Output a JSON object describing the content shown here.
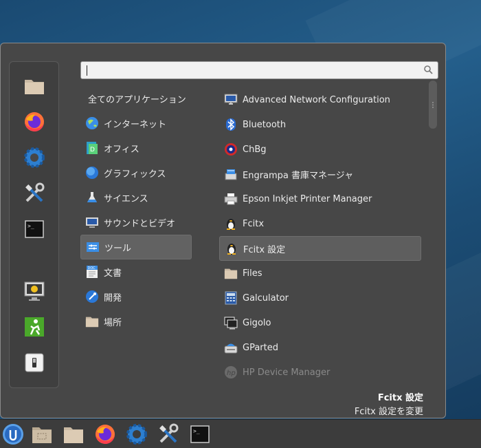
{
  "search": {
    "placeholder": ""
  },
  "categories": [
    {
      "label": "全てのアプリケーション",
      "icon": "none"
    },
    {
      "label": "インターネット",
      "icon": "globe-icon"
    },
    {
      "label": "オフィス",
      "icon": "office-icon"
    },
    {
      "label": "グラフィックス",
      "icon": "graphics-icon"
    },
    {
      "label": "サイエンス",
      "icon": "science-icon"
    },
    {
      "label": "サウンドとビデオ",
      "icon": "multimedia-icon"
    },
    {
      "label": "ツール",
      "icon": "tools-icon",
      "selected": true
    },
    {
      "label": "文書",
      "icon": "document-icon"
    },
    {
      "label": "開発",
      "icon": "development-icon"
    },
    {
      "label": "場所",
      "icon": "folder-icon"
    }
  ],
  "apps": [
    {
      "label": "Advanced Network Configuration",
      "icon": "network-icon"
    },
    {
      "label": "Bluetooth",
      "icon": "bluetooth-icon"
    },
    {
      "label": "ChBg",
      "icon": "chbg-icon"
    },
    {
      "label": "Engrampa 書庫マネージャ",
      "icon": "archive-icon"
    },
    {
      "label": "Epson Inkjet Printer Manager",
      "icon": "printer-icon"
    },
    {
      "label": "Fcitx",
      "icon": "penguin-icon"
    },
    {
      "label": "Fcitx 設定",
      "icon": "penguin-icon",
      "selected": true
    },
    {
      "label": "Files",
      "icon": "folder-icon"
    },
    {
      "label": "Galculator",
      "icon": "calculator-icon"
    },
    {
      "label": "Gigolo",
      "icon": "gigolo-icon"
    },
    {
      "label": "GParted",
      "icon": "gparted-icon"
    },
    {
      "label": "HP Device Manager",
      "icon": "hp-icon",
      "dim": true
    }
  ],
  "info": {
    "title": "Fcitx 設定",
    "description": "Fcitx 設定を変更"
  },
  "favorites": [
    "folder-icon",
    "firefox-icon",
    "settings-gear-icon",
    "tools-icon",
    "terminal-icon",
    "monitor-lock-icon",
    "logout-icon",
    "power-switch-icon"
  ],
  "panel": [
    "menu-icon",
    "show-desktop-icon",
    "folder-icon",
    "firefox-icon",
    "settings-gear-icon",
    "tools-icon",
    "terminal-icon"
  ],
  "colors": {
    "menu_bg": "#474747",
    "selection": "#5e5e5e",
    "panel_bg": "#3c3c3c"
  }
}
